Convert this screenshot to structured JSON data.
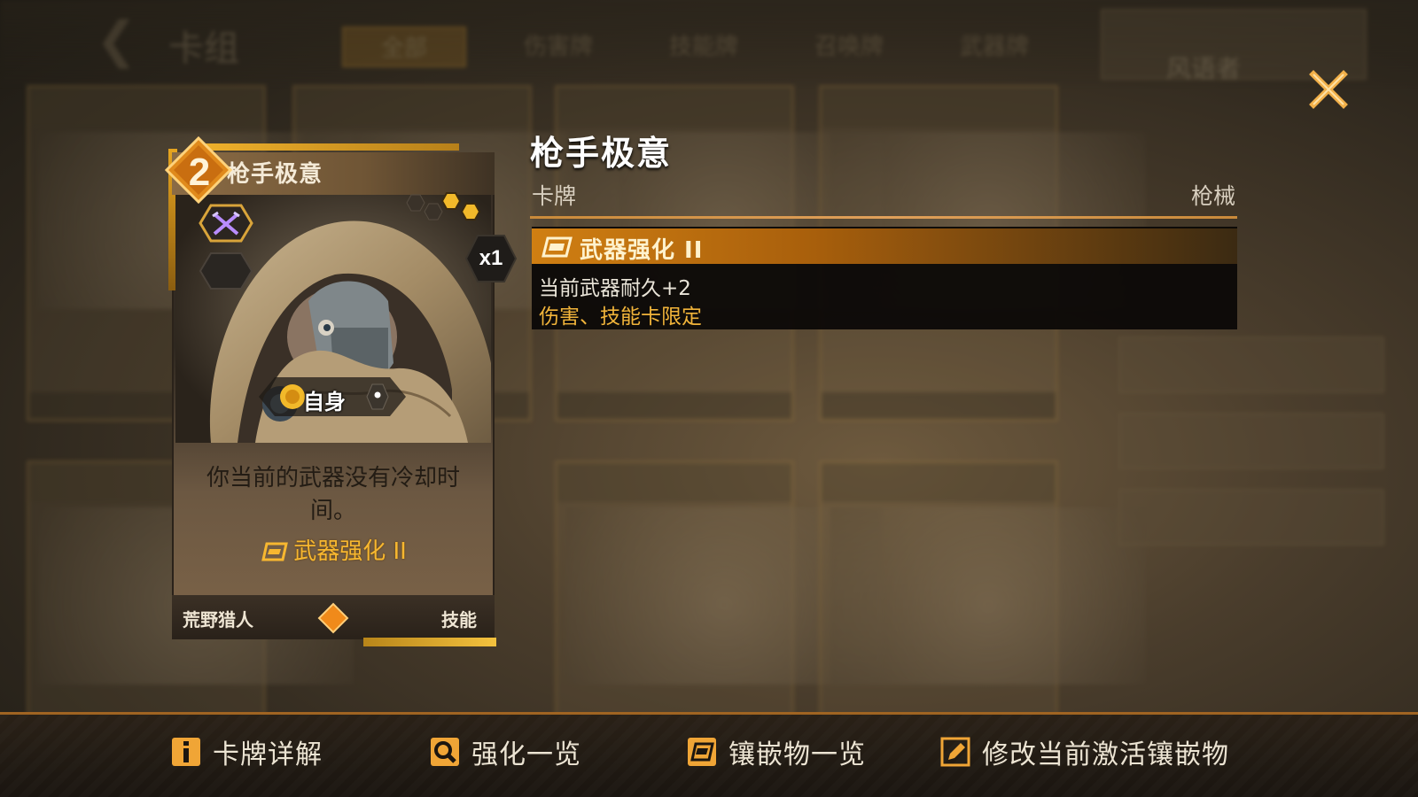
{
  "background": {
    "screen_title": "卡组",
    "tabs": [
      "全部",
      "伤害牌",
      "技能牌",
      "召唤牌",
      "武器牌"
    ],
    "character_name": "风语者"
  },
  "card": {
    "cost": "2",
    "name": "枪手极意",
    "count_badge": "x1",
    "target": "自身",
    "description": "你当前的武器没有冷却时间。",
    "keyword": "武器强化 II",
    "class": "荒野猎人",
    "type": "技能",
    "type_icon": "crossed-guns-icon"
  },
  "detail": {
    "title": "枪手极意",
    "subtitle": "卡牌",
    "tag": "枪械",
    "keyword": {
      "name": "武器强化 II",
      "effect": "当前武器耐久+2",
      "restriction": "伤害、技能卡限定"
    }
  },
  "bottom_bar": {
    "items": [
      {
        "label": "卡牌详解",
        "icon": "info-icon"
      },
      {
        "label": "强化一览",
        "icon": "magnifier-icon"
      },
      {
        "label": "镶嵌物一览",
        "icon": "inlay-icon"
      },
      {
        "label": "修改当前激活镶嵌物",
        "icon": "edit-icon"
      }
    ]
  },
  "colors": {
    "accent_gold": "#f1b43a",
    "keyword_orange": "#d07f12",
    "bar_border": "#a06422"
  }
}
